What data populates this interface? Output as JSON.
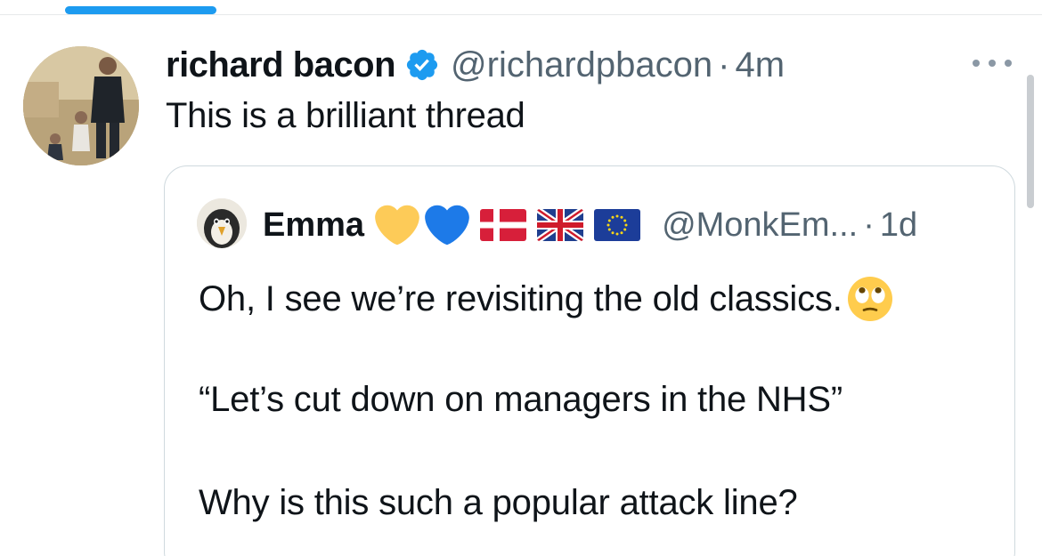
{
  "tweet": {
    "display_name": "richard bacon",
    "verified_icon": "verified-badge-icon",
    "handle": "@richardpbacon",
    "separator": "·",
    "time": "4m",
    "text": "This is a brilliant thread",
    "more_icon": "more-options-icon"
  },
  "quoted_tweet": {
    "display_name": "Emma",
    "name_emojis": [
      "yellow-heart-icon",
      "blue-heart-icon",
      "denmark-flag-icon",
      "uk-flag-icon",
      "eu-flag-icon"
    ],
    "handle": "@MonkEm...",
    "separator": "·",
    "time": "1d",
    "line1": "Oh, I see we’re revisiting the old classics.",
    "line1_emoji": "eye-roll-emoji-icon",
    "line2": "“Let’s cut down on managers in the NHS”",
    "line3": "Why is this such a popular attack line?"
  },
  "colors": {
    "accent": "#1d9bf0",
    "text_primary": "#0f1419",
    "text_secondary": "#536471",
    "border": "#cfd9de"
  }
}
